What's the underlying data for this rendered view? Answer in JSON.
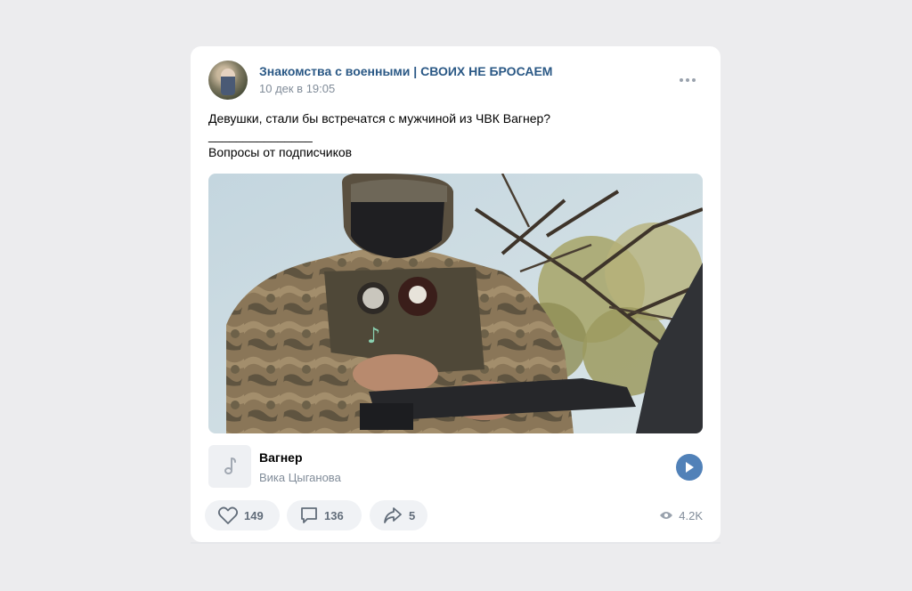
{
  "post": {
    "group_name": "Знакомства с военными | СВОИХ НЕ БРОСАЕМ",
    "date": "10 дек в 19:05",
    "text_lines": [
      "Девушки, стали бы встречатся с мужчиной из ЧВК Вагнер?",
      "_______________",
      "Вопросы от подписчиков"
    ]
  },
  "audio": {
    "title": "Вагнер",
    "artist": "Вика Цыганова"
  },
  "actions": {
    "likes": "149",
    "comments": "136",
    "shares": "5",
    "views": "4.2K"
  },
  "icons": {
    "more": "more-dots-icon",
    "like": "heart-icon",
    "comment": "comment-icon",
    "share": "share-arrow-icon",
    "views": "eye-icon",
    "play": "play-icon",
    "audio": "music-note-icon"
  },
  "colors": {
    "link": "#2a5885",
    "secondary": "#818c99",
    "accent": "#5181b8",
    "pill_bg": "#f0f2f5",
    "page_bg": "#ececee"
  }
}
